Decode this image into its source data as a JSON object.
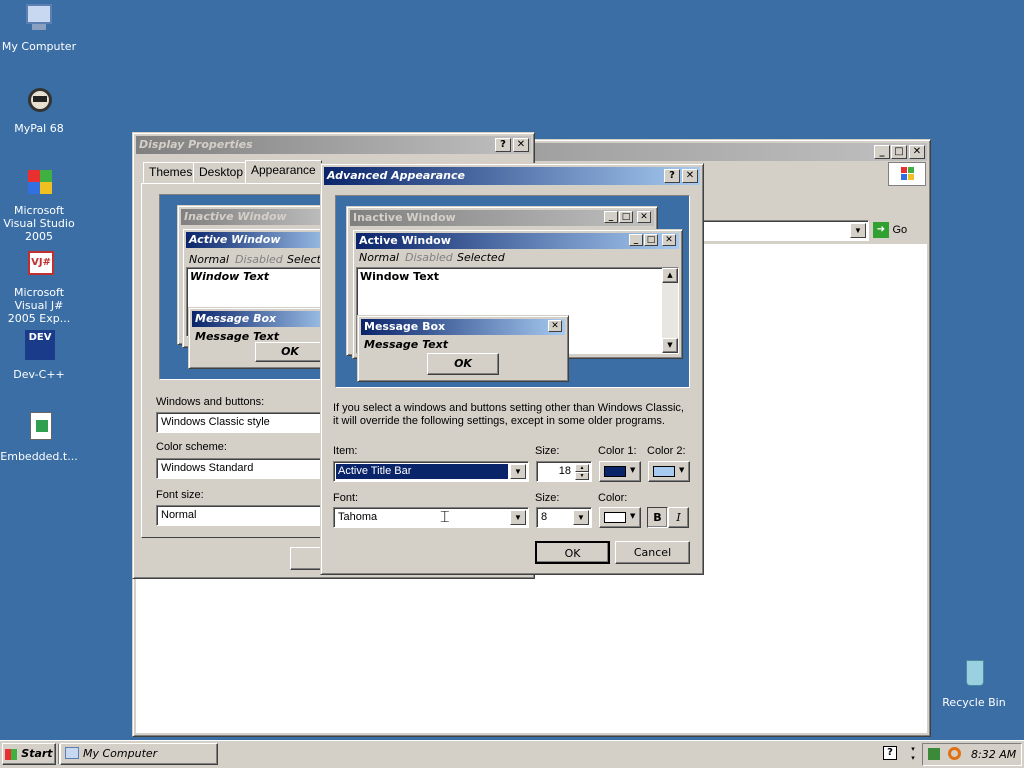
{
  "desktop": {
    "icons": [
      {
        "label": "My Computer",
        "icon": "my-computer-icon"
      },
      {
        "label": "MyPal 68",
        "icon": "mypal-icon"
      },
      {
        "label": "Microsoft Visual Studio 2005",
        "icon": "visual-studio-icon"
      },
      {
        "label": "Microsoft Visual J# 2005 Exp...",
        "icon": "visual-jsharp-icon"
      },
      {
        "label": "Dev-C++",
        "icon": "devcpp-icon"
      },
      {
        "label": "Embedded.t...",
        "icon": "embedded-file-icon"
      },
      {
        "label": "Recycle Bin",
        "icon": "recycle-bin-icon"
      }
    ]
  },
  "explorer": {
    "go_label": "Go"
  },
  "display_properties": {
    "title": "Display Properties",
    "tabs": [
      "Themes",
      "Desktop",
      "Appearance"
    ],
    "preview": {
      "inactive_title": "Inactive Window",
      "active_title": "Active Window",
      "menu_normal": "Normal",
      "menu_disabled": "Disabled",
      "menu_selected": "Selecte",
      "window_text": "Window Text",
      "message_box_title": "Message Box",
      "message_text": "Message Text",
      "ok": "OK"
    },
    "windows_buttons_label": "Windows and buttons:",
    "windows_buttons_value": "Windows Classic style",
    "color_scheme_label": "Color scheme:",
    "color_scheme_value": "Windows Standard",
    "font_size_label": "Font size:",
    "font_size_value": "Normal"
  },
  "advanced": {
    "title": "Advanced Appearance",
    "preview": {
      "inactive_title": "Inactive Window",
      "active_title": "Active Window",
      "menu_normal": "Normal",
      "menu_disabled": "Disabled",
      "menu_selected": "Selected",
      "window_text": "Window Text",
      "message_box_title": "Message Box",
      "message_text": "Message Text",
      "ok": "OK"
    },
    "info_line1": "If you select a windows and buttons setting other than Windows Classic,",
    "info_line2": "it will override the following settings, except in some older programs.",
    "item_label": "Item:",
    "item_value": "Active Title Bar",
    "size_label": "Size:",
    "size_value": "18",
    "color1_label": "Color 1:",
    "color2_label": "Color 2:",
    "color1": "#0a246a",
    "color2": "#a6caf0",
    "font_label": "Font:",
    "font_value": "Tahoma",
    "font_size_label": "Size:",
    "font_size_value": "8",
    "font_color_label": "Color:",
    "font_color": "#ffffff",
    "bold_label": "B",
    "italic_label": "I",
    "ok_label": "OK",
    "cancel_label": "Cancel"
  },
  "taskbar": {
    "start_label": "Start",
    "task_label": "My Computer",
    "time": "8:32 AM"
  }
}
